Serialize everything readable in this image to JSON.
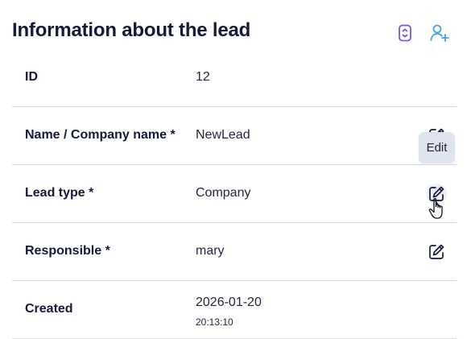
{
  "header": {
    "title": "Information about the lead",
    "icons": {
      "convert": "convert-lead-icon",
      "add_user": "add-user-icon"
    },
    "accent_color": "#6c5ce7",
    "add_user_color": "#3ea3e8"
  },
  "rows": [
    {
      "label": "ID",
      "value": "12"
    },
    {
      "label": "Name / Company name *",
      "value": "NewLead",
      "editable": true
    },
    {
      "label": "Lead type *",
      "value": "Company",
      "editable": true,
      "hovered": true
    },
    {
      "label": "Responsible *",
      "value": "mary",
      "editable": true
    },
    {
      "label": "Created",
      "value": "2026-01-20",
      "sub": "20:13:10"
    }
  ],
  "tooltip": {
    "text": "Edit"
  }
}
